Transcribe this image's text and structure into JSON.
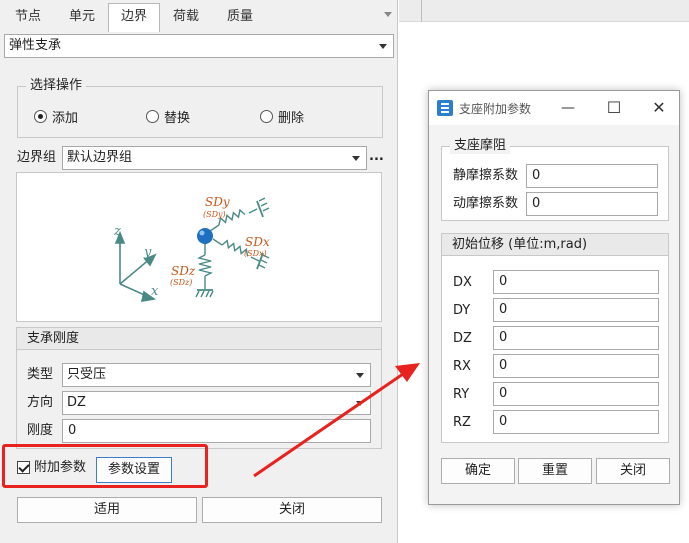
{
  "tabs": [
    {
      "label": "节点"
    },
    {
      "label": "单元"
    },
    {
      "label": "边界"
    },
    {
      "label": "荷载"
    },
    {
      "label": "质量"
    }
  ],
  "boundary_type": {
    "value": "弹性支承"
  },
  "operation": {
    "title": "选择操作",
    "options": [
      {
        "label": "添加",
        "selected": true
      },
      {
        "label": "替换",
        "selected": false
      },
      {
        "label": "删除",
        "selected": false
      }
    ]
  },
  "boundary_group": {
    "label": "边界组",
    "value": "默认边界组",
    "more": "..."
  },
  "diagram": {
    "sdy": "SDy",
    "sdy_sub": "(SDy)",
    "sdx": "SDx",
    "sdx_sub": "(SDx)",
    "sdz": "SDz",
    "sdz_sub": "(SDz)",
    "axis_z": "z",
    "axis_y": "y",
    "axis_x": "x"
  },
  "stiffness": {
    "title": "支承刚度",
    "type_label": "类型",
    "type_value": "只受压",
    "direction_label": "方向",
    "direction_value": "DZ",
    "stiffness_label": "刚度",
    "stiffness_value": "0"
  },
  "extra_params": {
    "checkbox_label": "附加参数",
    "checked": true,
    "settings_button": "参数设置"
  },
  "bottom_buttons": {
    "apply": "适用",
    "close": "关闭"
  },
  "dialog": {
    "title": "支座附加参数",
    "friction": {
      "title": "支座摩阻",
      "static_label": "静摩擦系数",
      "static_value": "0",
      "dynamic_label": "动摩擦系数",
      "dynamic_value": "0"
    },
    "displacement": {
      "title": "初始位移 (单位:m,rad)",
      "rows": [
        {
          "label": "DX",
          "value": "0"
        },
        {
          "label": "DY",
          "value": "0"
        },
        {
          "label": "DZ",
          "value": "0"
        },
        {
          "label": "RX",
          "value": "0"
        },
        {
          "label": "RY",
          "value": "0"
        },
        {
          "label": "RZ",
          "value": "0"
        }
      ]
    },
    "buttons": {
      "ok": "确定",
      "reset": "重置",
      "close": "关闭"
    }
  },
  "colors": {
    "highlight_red": "#e8231f",
    "diagram_orange": "#c0561b",
    "diagram_teal": "#4a8a86",
    "node_blue": "#1f6fc0"
  }
}
